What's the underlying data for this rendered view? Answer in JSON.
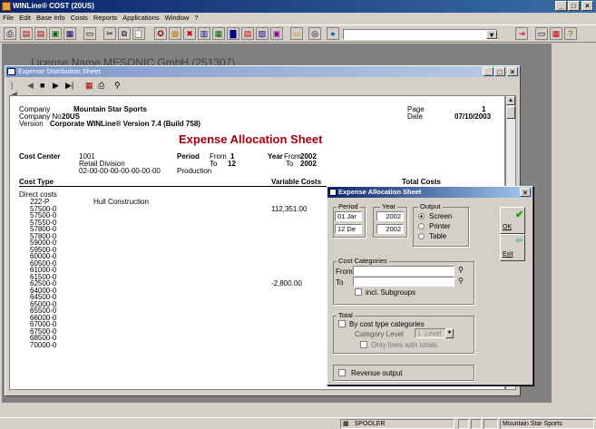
{
  "app": {
    "title": "WINLine® COST (20US)",
    "license": "License Name MESONIC GmbH (251307)"
  },
  "menu": [
    "File",
    "Edit",
    "Base Info",
    "Costs",
    "Reports",
    "Applications",
    "Window",
    "?"
  ],
  "child": {
    "title": "Expense Distribution Sheet"
  },
  "report": {
    "company_label": "Company",
    "company": "Mountain Star Sports",
    "company_no_label": "Company No.",
    "company_no": "20US",
    "version_label": "Version",
    "version": "Corporate WINLine® Version 7.4 (Build 758)",
    "page_label": "Page",
    "page": "1",
    "date_label": "Date",
    "date": "07/10/2003",
    "title": "Expense Allocation Sheet",
    "cc_label": "Cost Center",
    "cc_value": "1001",
    "cc_name": "Retail Division",
    "cc_code": "02-00-00-00-00-00-00-00",
    "cc_type": "Production",
    "period_label": "Period",
    "from_label": "From",
    "period_from": "1",
    "to_label": "To",
    "period_to": "12",
    "year_label": "Year",
    "year_from_label": "From",
    "year_from": "2002",
    "year_to_label": "To",
    "year_to": "2002",
    "cost_type_label": "Cost Type",
    "var_costs_label": "Variable Costs",
    "total_costs_label": "Total Costs",
    "section": "Direct costs",
    "rows": [
      {
        "code": "222-P",
        "name": "Hull Construction",
        "var": ""
      },
      {
        "code": "57500-0",
        "name": "",
        "var": "112,351.00"
      },
      {
        "code": "57500-0",
        "name": "",
        "var": ""
      },
      {
        "code": "57550-0",
        "name": "",
        "var": ""
      },
      {
        "code": "57800-0",
        "name": "",
        "var": ""
      },
      {
        "code": "57800-0",
        "name": "",
        "var": ""
      },
      {
        "code": "59000-0",
        "name": "",
        "var": ""
      },
      {
        "code": "59500-0",
        "name": "",
        "var": ""
      },
      {
        "code": "60000-0",
        "name": "",
        "var": ""
      },
      {
        "code": "60500-0",
        "name": "",
        "var": ""
      },
      {
        "code": "61000-0",
        "name": "",
        "var": ""
      },
      {
        "code": "61500-0",
        "name": "",
        "var": ""
      },
      {
        "code": "62500-0",
        "name": "",
        "var": "-2,800.00"
      },
      {
        "code": "64000-0",
        "name": "",
        "var": ""
      },
      {
        "code": "64500-0",
        "name": "",
        "var": ""
      },
      {
        "code": "65000-0",
        "name": "",
        "var": ""
      },
      {
        "code": "65500-0",
        "name": "",
        "var": ""
      },
      {
        "code": "66000-0",
        "name": "",
        "var": ""
      },
      {
        "code": "67000-0",
        "name": "",
        "var": ""
      },
      {
        "code": "67500-0",
        "name": "",
        "var": ""
      },
      {
        "code": "68500-0",
        "name": "",
        "var": ""
      },
      {
        "code": "70000-0",
        "name": "",
        "var": ""
      }
    ]
  },
  "dialog": {
    "title": "Expense Allocation Sheet",
    "period_label": "Period",
    "period_from": "01 Jar",
    "period_to": "12 De",
    "year_label": "Year",
    "year_from": "2002",
    "year_to": "2002",
    "output_label": "Output",
    "screen": "Screen",
    "printer": "Printer",
    "table": "Table",
    "ok": "OK",
    "exit": "Exit",
    "cost_categories_label": "Cost Categories",
    "from_label": "From",
    "to_label": "To",
    "incl_subgroups": "incl. Subgroups",
    "total_label": "Total",
    "by_cost_type": "By cost type categories",
    "category_level_label": "Category Level",
    "category_level": "1 .Level",
    "only_lines": "Only lines with totals",
    "revenue_output": "Revenue output"
  },
  "status": {
    "spooler": "SPOOLER",
    "company": "Mountain Star Sports"
  }
}
